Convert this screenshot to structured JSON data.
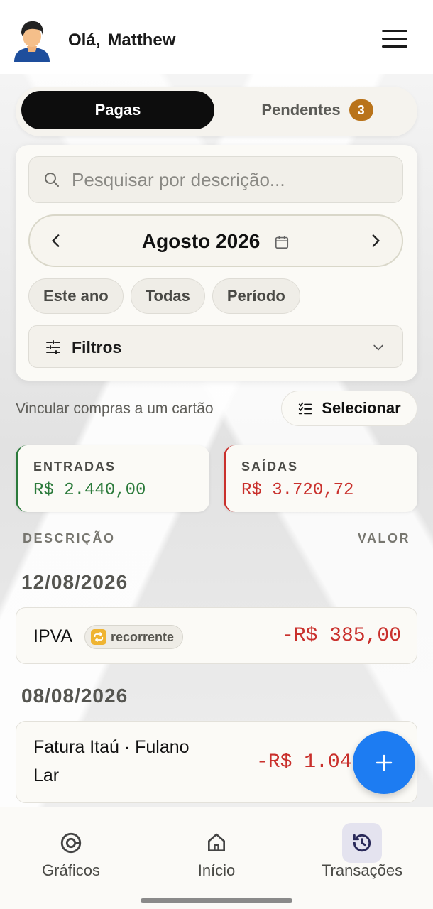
{
  "header": {
    "greeting": "Olá,",
    "user_name": "Matthew"
  },
  "tabs": {
    "paid_label": "Pagas",
    "pending_label": "Pendentes",
    "pending_count": "3"
  },
  "filters": {
    "search_placeholder": "Pesquisar por descrição...",
    "month_label": "Agosto 2026",
    "chips": [
      "Este ano",
      "Todas",
      "Período"
    ],
    "filters_label": "Filtros"
  },
  "actions": {
    "link_cards_text": "Vincular compras a um cartão",
    "select_label": "Selecionar"
  },
  "summary": {
    "income_label": "ENTRADAS",
    "income_value": "R$ 2.440,00",
    "income_color": "#2b7a3b",
    "expense_label": "SAÍDAS",
    "expense_value": "R$ 3.720,72",
    "expense_color": "#c9302c"
  },
  "list": {
    "col_description": "DESCRIÇÃO",
    "col_value": "VALOR",
    "groups": [
      {
        "date": "12/08/2026",
        "items": [
          {
            "description": "IPVA",
            "tag": "recorrente",
            "value": "-R$ 385,00"
          }
        ]
      },
      {
        "date": "08/08/2026",
        "items": [
          {
            "description_line1": "Fatura Itaú · Fulano",
            "description_line2": "Lar",
            "value": "-R$ 1.04"
          }
        ]
      }
    ]
  },
  "fab": {
    "icon": "plus-icon"
  },
  "bottom_nav": [
    {
      "label": "Gráficos",
      "icon": "chart-donut-icon"
    },
    {
      "label": "Início",
      "icon": "home-icon"
    },
    {
      "label": "Transações",
      "icon": "history-icon",
      "active": true
    }
  ],
  "colors": {
    "accent": "#1d7cf2",
    "pending_badge": "#b9731a"
  }
}
